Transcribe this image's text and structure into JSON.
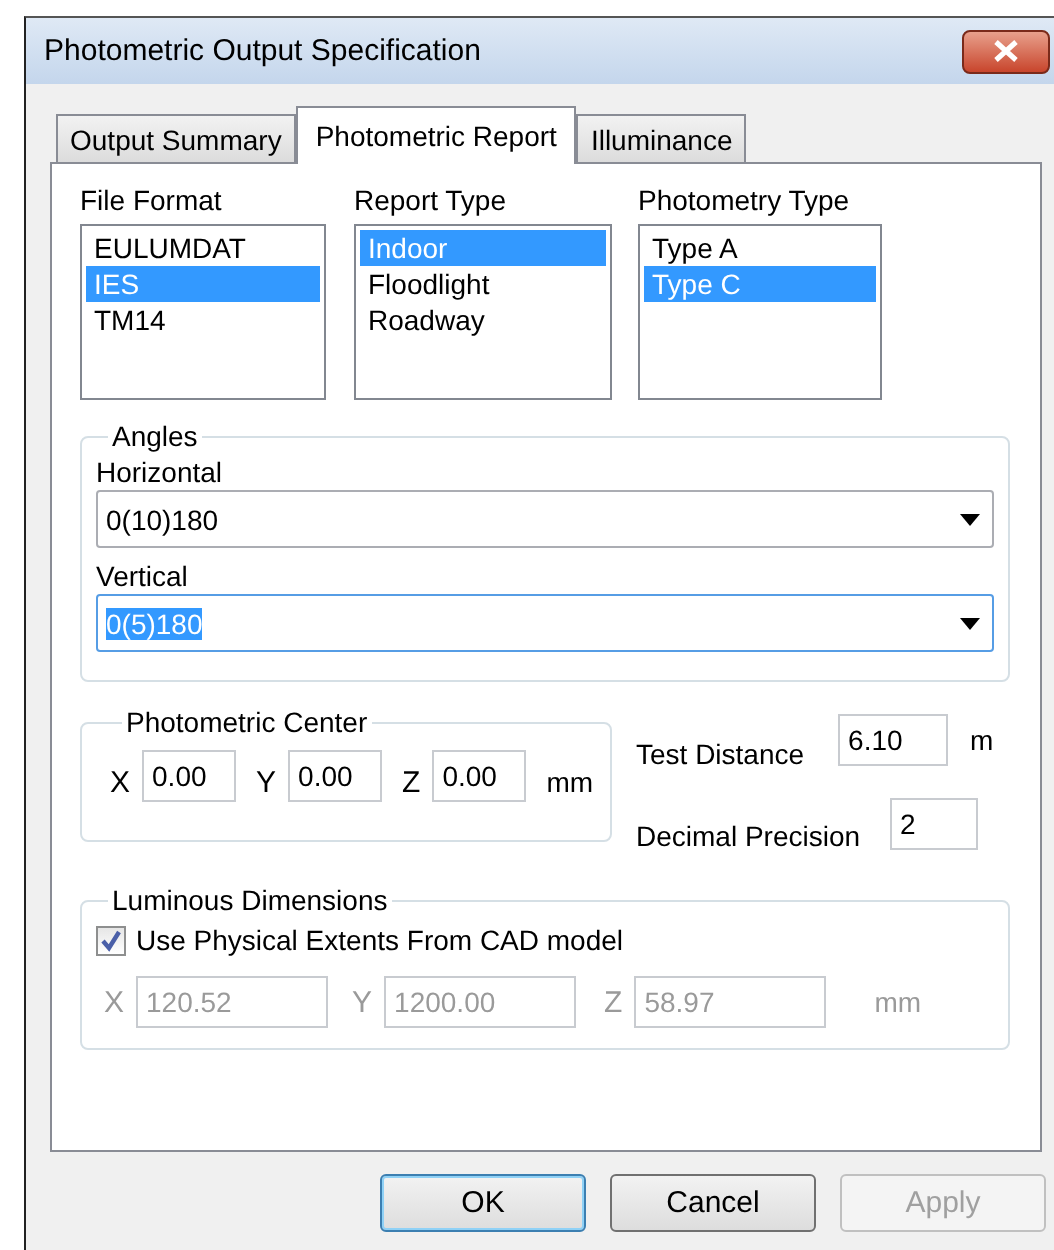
{
  "window": {
    "title": "Photometric Output Specification"
  },
  "tabs": [
    {
      "label": "Output Summary",
      "selected": false
    },
    {
      "label": "Photometric Report",
      "selected": true
    },
    {
      "label": "Illuminance",
      "selected": false
    }
  ],
  "lists": [
    {
      "label": "File Format",
      "items": [
        {
          "text": "EULUMDAT",
          "selected": false
        },
        {
          "text": "IES",
          "selected": true
        },
        {
          "text": "TM14",
          "selected": false
        }
      ]
    },
    {
      "label": "Report Type",
      "items": [
        {
          "text": "Indoor",
          "selected": true
        },
        {
          "text": "Floodlight",
          "selected": false
        },
        {
          "text": "Roadway",
          "selected": false
        }
      ]
    },
    {
      "label": "Photometry Type",
      "items": [
        {
          "text": "Type A",
          "selected": false
        },
        {
          "text": "Type C",
          "selected": true
        }
      ]
    }
  ],
  "angles": {
    "title": "Angles",
    "fields": [
      {
        "label": "Horizontal",
        "value": "0(10)180",
        "focused": false
      },
      {
        "label": "Vertical",
        "value": "0(5)180",
        "focused": true
      }
    ]
  },
  "photometric_center": {
    "title": "Photometric Center",
    "fields": [
      {
        "label": "X",
        "value": "0.00"
      },
      {
        "label": "Y",
        "value": "0.00"
      },
      {
        "label": "Z",
        "value": "0.00"
      }
    ],
    "unit": "mm"
  },
  "test_distance": {
    "label": "Test Distance",
    "value": "6.10",
    "unit": "m"
  },
  "decimal_precision": {
    "label": "Decimal Precision",
    "value": "2"
  },
  "luminous_dimensions": {
    "title": "Luminous Dimensions",
    "checkbox": {
      "label": "Use Physical Extents From CAD model",
      "checked": true
    },
    "disabled": true,
    "fields": [
      {
        "label": "X",
        "value": "120.52"
      },
      {
        "label": "Y",
        "value": "1200.00"
      },
      {
        "label": "Z",
        "value": "58.97"
      }
    ],
    "unit": "mm"
  },
  "buttons": [
    {
      "label": "OK",
      "default": true,
      "disabled": false
    },
    {
      "label": "Cancel",
      "default": false,
      "disabled": false
    },
    {
      "label": "Apply",
      "default": false,
      "disabled": true
    }
  ]
}
